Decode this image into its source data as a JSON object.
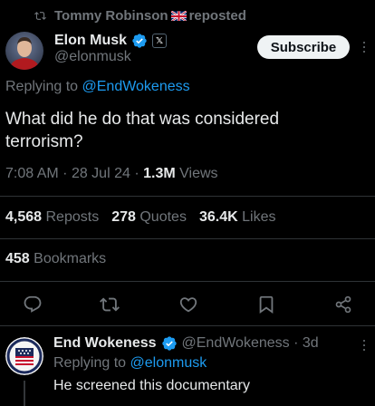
{
  "repost_header": {
    "reposter": "Tommy Robinson",
    "flag_icon": "uk-flag-icon",
    "suffix": "reposted"
  },
  "main_tweet": {
    "author": {
      "name": "Elon Musk",
      "handle": "@elonmusk",
      "verified_color": "#1d9bf0"
    },
    "subscribe_label": "Subscribe",
    "replying_to_prefix": "Replying to",
    "replying_to_handle": "@EndWokeness",
    "text": "What did he do that was considered terrorism?",
    "time": "7:08 AM",
    "date": "28 Jul 24",
    "views_count": "1.3M",
    "views_label": "Views",
    "stats": {
      "reposts": {
        "count": "4,568",
        "label": "Reposts"
      },
      "quotes": {
        "count": "278",
        "label": "Quotes"
      },
      "likes": {
        "count": "36.4K",
        "label": "Likes"
      },
      "bookmarks": {
        "count": "458",
        "label": "Bookmarks"
      }
    },
    "actions": [
      "reply-icon",
      "repost-icon",
      "like-icon",
      "bookmark-icon",
      "share-icon"
    ]
  },
  "reply_tweet": {
    "author": {
      "name": "End Wokeness",
      "handle": "@EndWokeness",
      "time": "3d"
    },
    "replying_to_prefix": "Replying to",
    "replying_to_handle": "@elonmusk",
    "text": "He screened this documentary"
  },
  "colors": {
    "background": "#000000",
    "text": "#e7e9ea",
    "muted": "#71767b",
    "accent": "#1d9bf0",
    "divider": "#2f3336"
  }
}
